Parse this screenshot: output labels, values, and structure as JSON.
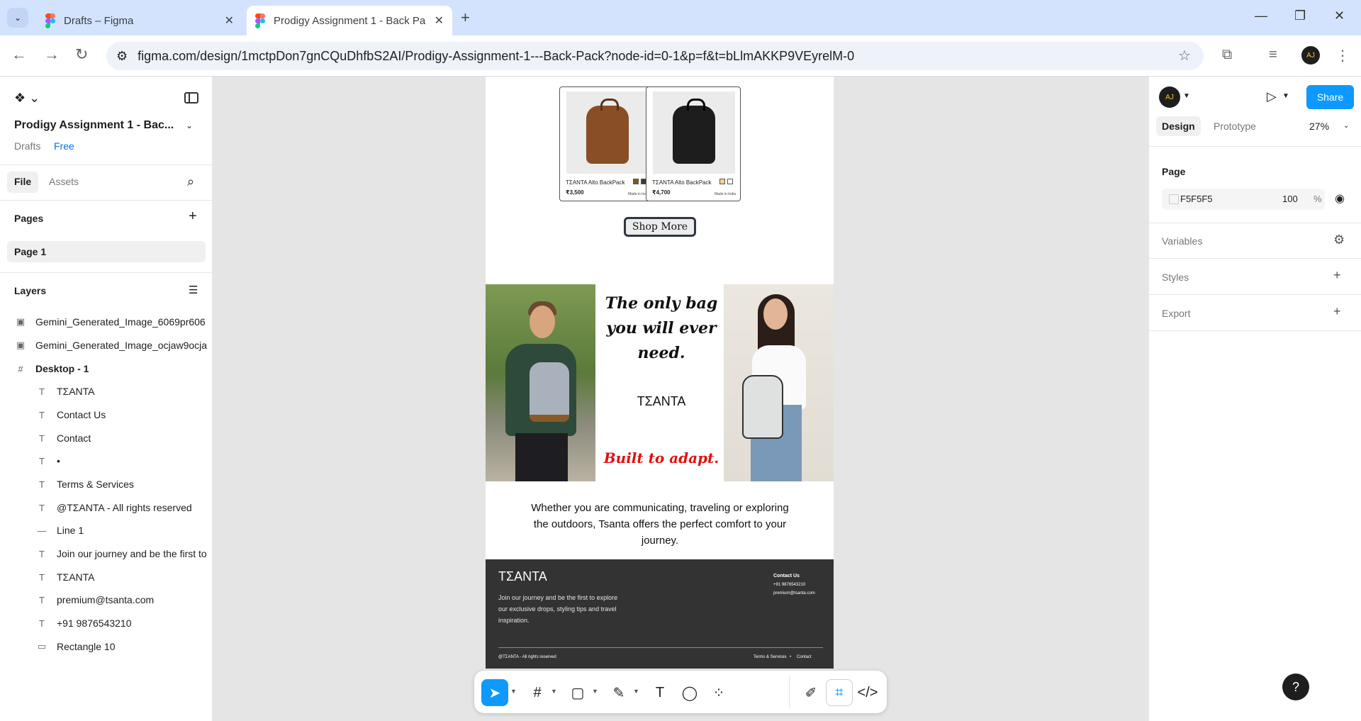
{
  "browser": {
    "tabs": [
      {
        "title": "Drafts – Figma"
      },
      {
        "title": "Prodigy Assignment 1 - Back Pa"
      }
    ],
    "url": "figma.com/design/1mctpDon7gnCQuDhfbS2AI/Prodigy-Assignment-1---Back-Pack?node-id=0-1&p=f&t=bLlmAKKP9VEyrelM-0",
    "avatar_initials": "AJ"
  },
  "left_panel": {
    "project_title": "Prodigy Assignment 1 - Bac...",
    "drafts": "Drafts",
    "plan": "Free",
    "tabs": {
      "file": "File",
      "assets": "Assets"
    },
    "pages_heading": "Pages",
    "pages": [
      "Page 1"
    ],
    "layers_heading": "Layers",
    "layers": [
      {
        "label": "Gemini_Generated_Image_6069pr606",
        "icon": "image-icon"
      },
      {
        "label": "Gemini_Generated_Image_ocjaw9ocja",
        "icon": "image-icon"
      },
      {
        "label": "Desktop - 1",
        "icon": "frame-icon"
      },
      {
        "label": "TΣANTA",
        "icon": "text-icon"
      },
      {
        "label": "Contact Us",
        "icon": "text-icon"
      },
      {
        "label": "Contact",
        "icon": "text-icon"
      },
      {
        "label": "•",
        "icon": "text-icon"
      },
      {
        "label": "Terms & Services",
        "icon": "text-icon"
      },
      {
        "label": "@TΣANTA - All rights reserved",
        "icon": "text-icon"
      },
      {
        "label": "Line 1",
        "icon": "line-icon"
      },
      {
        "label": "Join our journey and be the first to",
        "icon": "text-icon"
      },
      {
        "label": "TΣANTA",
        "icon": "text-icon"
      },
      {
        "label": "premium@tsanta.com",
        "icon": "text-icon"
      },
      {
        "label": "+91 9876543210",
        "icon": "text-icon"
      },
      {
        "label": "Rectangle 10",
        "icon": "rectangle-icon"
      }
    ]
  },
  "canvas": {
    "products": [
      {
        "name": "TΣANTA  Alto BackPack",
        "price": "₹3,500",
        "made": "Made in India",
        "swatches": [
          "#7a5a1e",
          "#3b3b2b"
        ],
        "bag_color": "#8a4e26"
      },
      {
        "name": "TΣANTA  Alto BackPack",
        "price": "₹4,700",
        "made": "Made in India",
        "swatches": [
          "#f0d58a",
          "#ffffff"
        ],
        "bag_color": "#1d1d1d"
      }
    ],
    "shop_button": "Shop More",
    "tagline_1": "The only bag you will ever need.",
    "brand": "TΣANTA",
    "tagline_2": "Built to adapt.",
    "paragraph": "Whether you are communicating, traveling or exploring the outdoors, Tsanta offers the perfect comfort to your journey.",
    "footer": {
      "brand": "TΣANTA",
      "description": "Join our journey and be the first to explore our exclusive drops, styling tips and travel inspiration.",
      "contact_heading": "Contact Us",
      "phone": "+91 9876543210",
      "email": "premium@tsanta.com",
      "copyright": "@TΣANTA - All rights reserved",
      "terms": "Terms & Services",
      "dot": "•",
      "contact": "Contact"
    }
  },
  "right_panel": {
    "avatar_initials": "AJ",
    "share": "Share",
    "tabs": {
      "design": "Design",
      "prototype": "Prototype"
    },
    "zoom": "27%",
    "page_heading": "Page",
    "fill_hex": "F5F5F5",
    "fill_opacity": "100",
    "fill_pct": "%",
    "sections": [
      "Variables",
      "Styles",
      "Export"
    ],
    "help": "?"
  },
  "colors": {
    "accent": "#0d99ff",
    "tab_bar": "#d3e3fd",
    "footer_bg": "#333333",
    "tagline_red": "#e01010",
    "canvas_bg": "#e5e5e5"
  }
}
